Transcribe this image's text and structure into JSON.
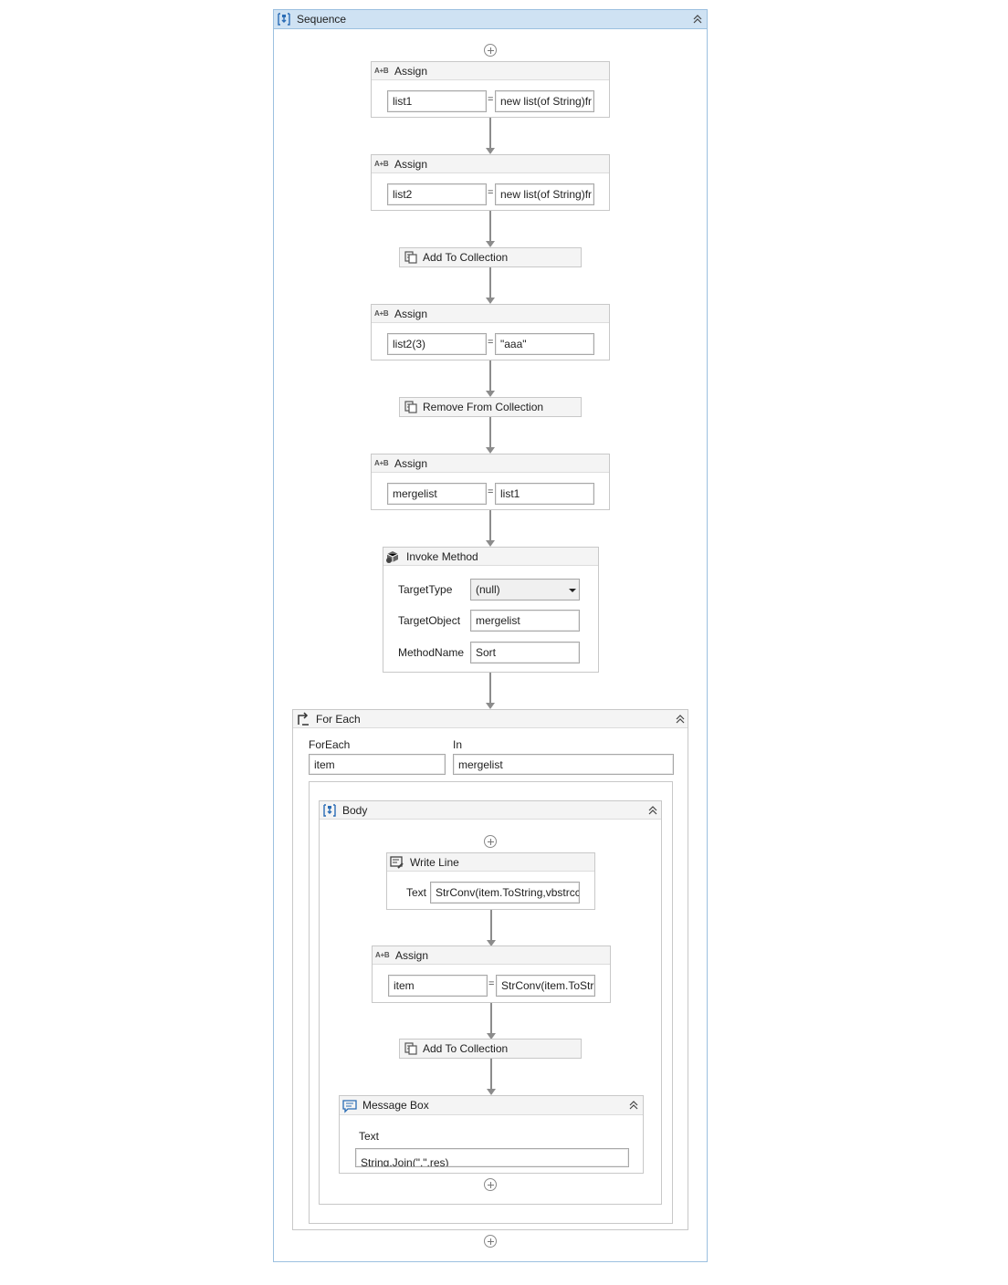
{
  "sequence": {
    "title": "Sequence"
  },
  "assign1": {
    "title": "Assign",
    "to": "list1",
    "value": "new list(of String)fr"
  },
  "assign2": {
    "title": "Assign",
    "to": "list2",
    "value": "new list(of String)fr"
  },
  "add1": {
    "title": "Add To Collection"
  },
  "assign3": {
    "title": "Assign",
    "to": "list2(3)",
    "value": "\"aaa\""
  },
  "remove1": {
    "title": "Remove From Collection"
  },
  "assign4": {
    "title": "Assign",
    "to": "mergelist",
    "value": "list1"
  },
  "invoke": {
    "title": "Invoke Method",
    "target_type_label": "TargetType",
    "target_type_value": "(null)",
    "target_object_label": "TargetObject",
    "target_object_value": "mergelist",
    "method_name_label": "MethodName",
    "method_name_value": "Sort"
  },
  "foreach": {
    "title": "For Each",
    "foreach_label": "ForEach",
    "foreach_value": "item",
    "in_label": "In",
    "in_value": "mergelist"
  },
  "body": {
    "title": "Body"
  },
  "writeline": {
    "title": "Write Line",
    "text_label": "Text",
    "text_value": "StrConv(item.ToString,vbstrcc"
  },
  "assign5": {
    "title": "Assign",
    "to": "item",
    "value": "StrConv(item.ToStr"
  },
  "add2": {
    "title": "Add To Collection"
  },
  "msgbox": {
    "title": "Message Box",
    "text_label": "Text",
    "text_value": "String.Join(\",\",res)"
  },
  "assign_symbol": "=",
  "assign_icon_text": "A+B",
  "icons": [
    "sequence-icon",
    "collapse-icon",
    "add-activity-icon",
    "assign-icon",
    "collection-icon",
    "invoke-method-icon",
    "for-each-icon",
    "write-line-icon",
    "message-box-icon",
    "dropdown-arrow-icon"
  ]
}
